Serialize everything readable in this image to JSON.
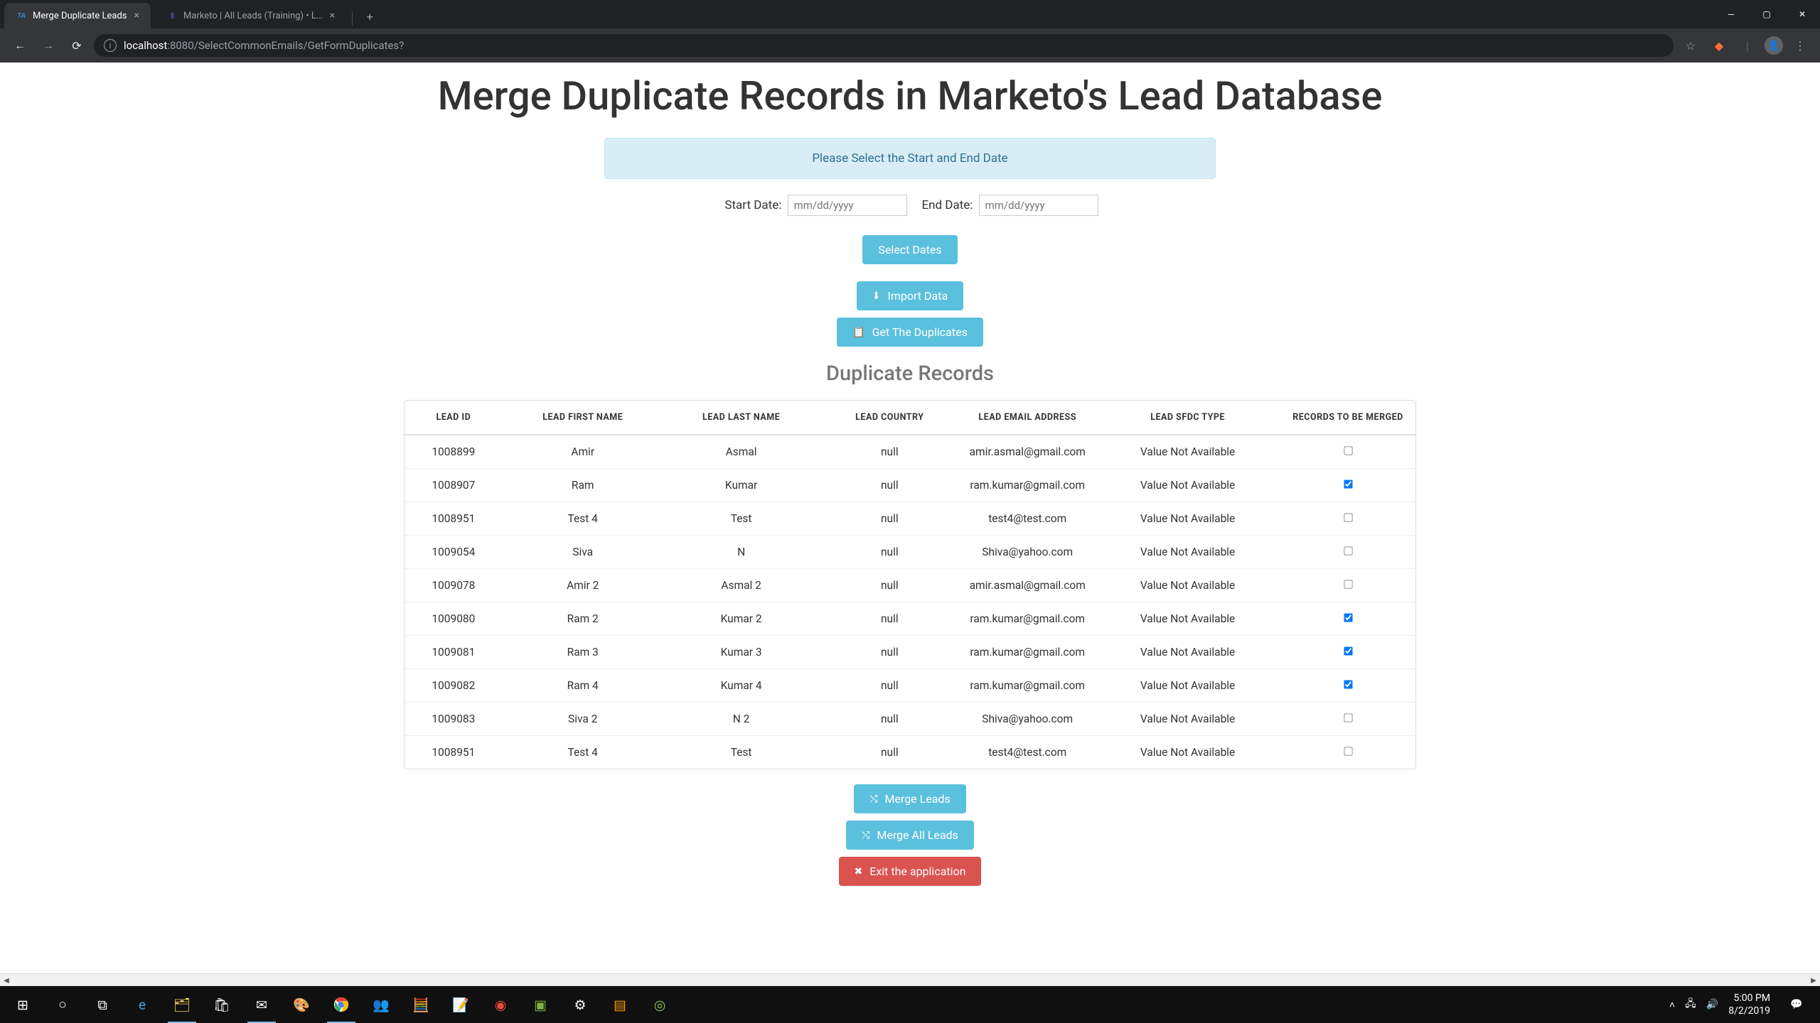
{
  "browser": {
    "tabs": [
      {
        "title": "Merge Duplicate Leads",
        "favicon": "TA",
        "active": true
      },
      {
        "title": "Marketo | All Leads (Training) • L…",
        "favicon": "|||",
        "active": false
      }
    ],
    "url_host": "localhost",
    "url_port": ":8080",
    "url_path": "/SelectCommonEmails/GetFormDuplicates?"
  },
  "page": {
    "title": "Merge Duplicate Records in Marketo's Lead Database",
    "banner": "Please Select the Start and End Date",
    "start_date_label": "Start Date:",
    "end_date_label": "End Date:",
    "date_placeholder": "mm/dd/yyyy",
    "select_dates_btn": "Select Dates",
    "import_btn": "Import Data",
    "get_dup_btn": "Get The Duplicates",
    "subheading": "Duplicate Records",
    "merge_btn": "Merge Leads",
    "merge_all_btn": "Merge All Leads",
    "exit_btn": "Exit the application"
  },
  "table": {
    "headers": [
      "Lead Id",
      "Lead First Name",
      "Lead Last Name",
      "Lead Country",
      "Lead Email Address",
      "Lead Sfdc Type",
      "Records to be Merged"
    ],
    "rows": [
      {
        "id": "1008899",
        "first": "Amir",
        "last": "Asmal",
        "country": "null",
        "email": "amir.asmal@gmail.com",
        "sfdc": "Value Not Available",
        "checked": false
      },
      {
        "id": "1008907",
        "first": "Ram",
        "last": "Kumar",
        "country": "null",
        "email": "ram.kumar@gmail.com",
        "sfdc": "Value Not Available",
        "checked": true
      },
      {
        "id": "1008951",
        "first": "Test 4",
        "last": "Test",
        "country": "null",
        "email": "test4@test.com",
        "sfdc": "Value Not Available",
        "checked": false
      },
      {
        "id": "1009054",
        "first": "Siva",
        "last": "N",
        "country": "null",
        "email": "Shiva@yahoo.com",
        "sfdc": "Value Not Available",
        "checked": false
      },
      {
        "id": "1009078",
        "first": "Amir 2",
        "last": "Asmal 2",
        "country": "null",
        "email": "amir.asmal@gmail.com",
        "sfdc": "Value Not Available",
        "checked": false
      },
      {
        "id": "1009080",
        "first": "Ram 2",
        "last": "Kumar 2",
        "country": "null",
        "email": "ram.kumar@gmail.com",
        "sfdc": "Value Not Available",
        "checked": true
      },
      {
        "id": "1009081",
        "first": "Ram 3",
        "last": "Kumar 3",
        "country": "null",
        "email": "ram.kumar@gmail.com",
        "sfdc": "Value Not Available",
        "checked": true
      },
      {
        "id": "1009082",
        "first": "Ram 4",
        "last": "Kumar 4",
        "country": "null",
        "email": "ram.kumar@gmail.com",
        "sfdc": "Value Not Available",
        "checked": true
      },
      {
        "id": "1009083",
        "first": "Siva 2",
        "last": "N 2",
        "country": "null",
        "email": "Shiva@yahoo.com",
        "sfdc": "Value Not Available",
        "checked": false
      },
      {
        "id": "1008951",
        "first": "Test 4",
        "last": "Test",
        "country": "null",
        "email": "test4@test.com",
        "sfdc": "Value Not Available",
        "checked": false
      }
    ]
  },
  "system": {
    "time": "5:00 PM",
    "date": "8/2/2019"
  }
}
